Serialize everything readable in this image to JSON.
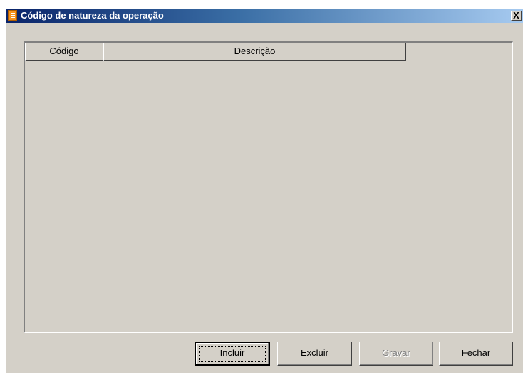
{
  "window": {
    "title": "Código de natureza da operação",
    "close_glyph": "X"
  },
  "grid": {
    "columns": [
      "Código",
      "Descrição"
    ],
    "rows": []
  },
  "buttons": {
    "incluir": "Incluir",
    "excluir": "Excluir",
    "gravar": "Gravar",
    "fechar": "Fechar"
  },
  "icons": {
    "title": "document-icon",
    "close": "close-icon"
  },
  "colors": {
    "face": "#d4d0c8",
    "title_start": "#0a246a",
    "title_end": "#a6caf0",
    "icon": "#f7941d"
  }
}
